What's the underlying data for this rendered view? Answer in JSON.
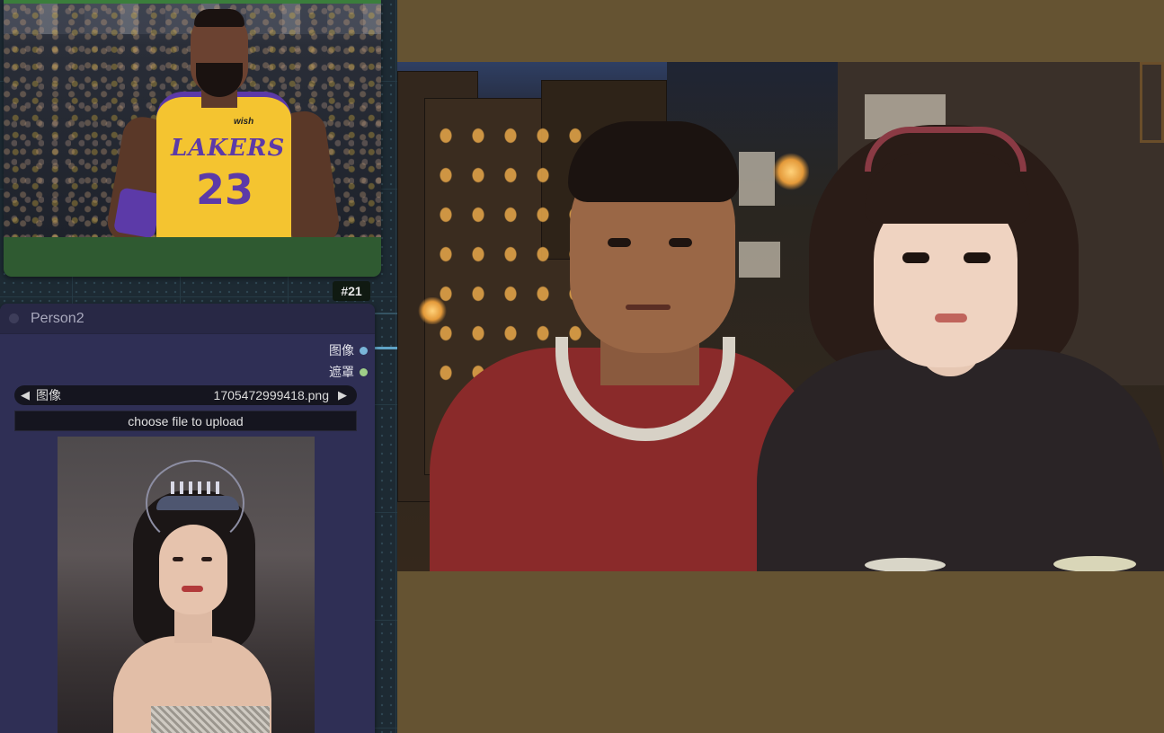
{
  "canvas": {
    "background": "#1d2a33"
  },
  "image_node": {
    "color": "#2f5a31",
    "node_id_badge": "#21",
    "image_alt": "basketball player photo"
  },
  "person2_node": {
    "title": "Person2",
    "color": "#2f2f55",
    "outputs": [
      {
        "label": "图像",
        "socket_color": "#79b5d8"
      },
      {
        "label": "遮罩",
        "socket_color": "#9fcf88"
      }
    ],
    "image_combo": {
      "label": "图像",
      "value": "1705472999418.png",
      "left_arrow": "◀",
      "right_arrow": "▶"
    },
    "upload_button": "choose file to upload",
    "image_alt": "woman portrait photo"
  },
  "preview": {
    "background": "#655332",
    "image_alt": "generated illustration of two people"
  }
}
